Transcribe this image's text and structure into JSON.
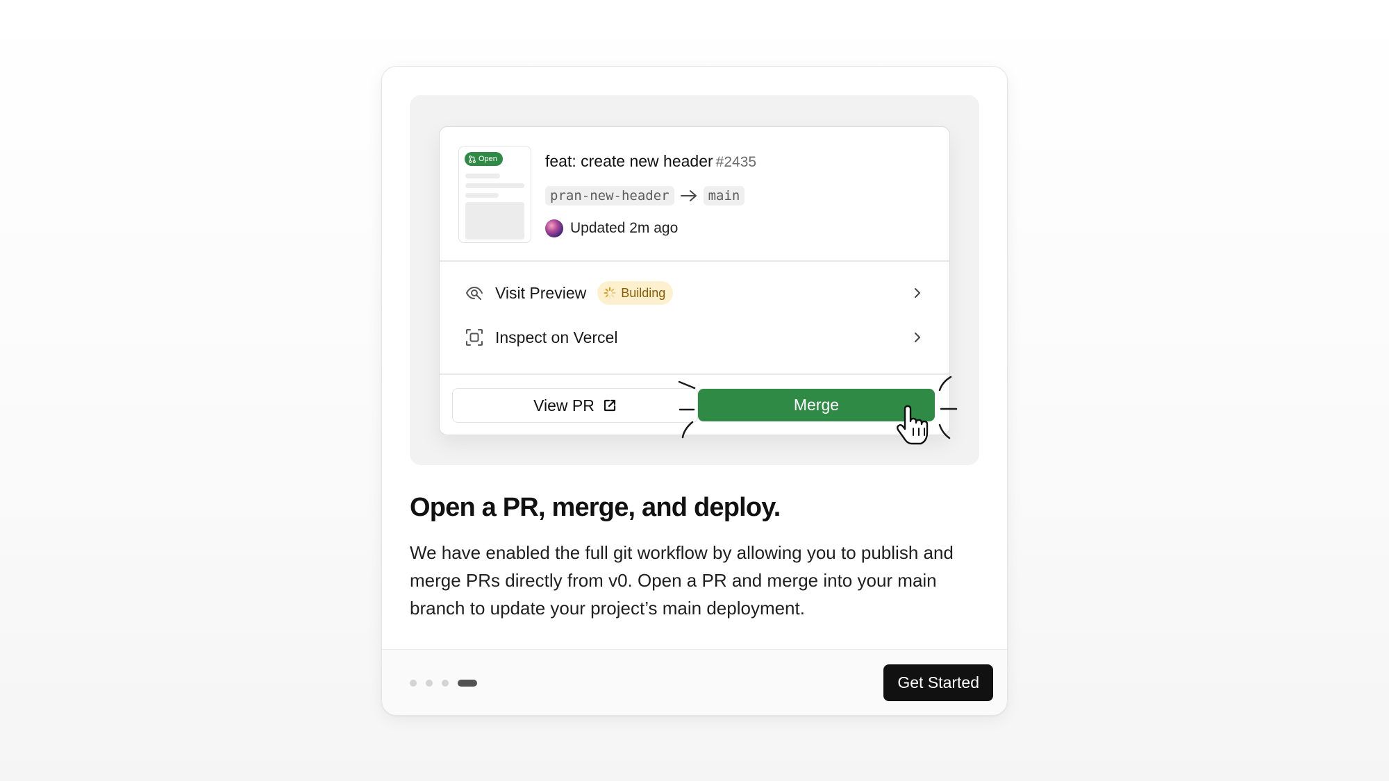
{
  "illustration": {
    "pr": {
      "badge": "Open",
      "title": "feat: create new header",
      "number": "#2435",
      "source_branch": "pran-new-header",
      "target_branch": "main",
      "updated": "Updated 2m ago"
    },
    "actions": [
      {
        "label": "Visit Preview",
        "icon": "eye-icon",
        "status": "Building"
      },
      {
        "label": "Inspect on Vercel",
        "icon": "inspect-frame-icon"
      }
    ],
    "buttons": {
      "view_pr": "View PR",
      "merge": "Merge"
    }
  },
  "content": {
    "headline": "Open a PR, merge, and deploy.",
    "description": "We have enabled the full git workflow by allowing you to publish and merge PRs directly from v0. Open a PR and merge into your main branch to update your project’s main deployment."
  },
  "footer": {
    "pagination": {
      "total": 4,
      "active": 4
    },
    "cta": "Get Started"
  },
  "colors": {
    "merge_green": "#2f8a45",
    "building_bg": "#fdf0cf",
    "building_text": "#8a5a00",
    "cta_bg": "#111111"
  }
}
